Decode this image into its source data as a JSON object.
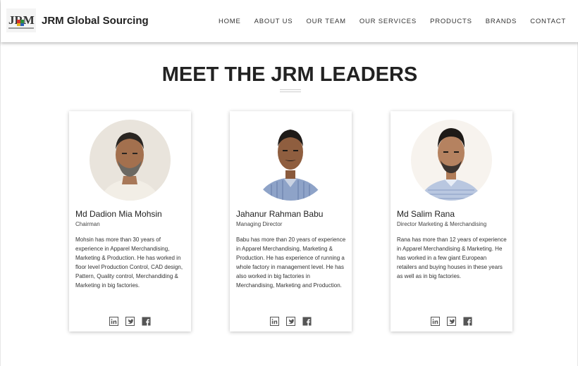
{
  "header": {
    "brand": "JRM Global Sourcing",
    "logo_icon": "jrm-logo-icon",
    "nav": [
      "HOME",
      "ABOUT US",
      "OUR TEAM",
      "OUR SERVICES",
      "PRODUCTS",
      "BRANDS",
      "CONTACT"
    ]
  },
  "section": {
    "title": "MEET THE JRM LEADERS"
  },
  "leaders": [
    {
      "name": "Md Dadion Mia Mohsin",
      "role": "Chairman",
      "bio": "Mohsin has more than 30 years of experience in Apparel Merchandising, Marketing & Production. He has worked in floor level Production Control, CAD design, Pattern, Quality control, Merchandiding & Marketing in big factories."
    },
    {
      "name": "Jahanur Rahman Babu",
      "role": "Managing Director",
      "bio": "Babu has more than 20 years of experience in Apparel Merchandising, Marketing & Production. He has experience of running a whole factory in management level. He has also worked in big factories in Merchandising, Marketing and Production."
    },
    {
      "name": "Md Salim Rana",
      "role": "Director Marketing & Merchandising",
      "bio": "Rana has more than 12 years of experience in Apparel Merchandising & Marketing. He has worked in a few giant European retailers and buying houses in these years as well as in big factories."
    }
  ],
  "social_icons": [
    "linkedin-icon",
    "twitter-icon",
    "facebook-icon"
  ],
  "colors": {
    "text": "#222222",
    "icon": "#555555",
    "photo_bg": "#e9e4dc"
  }
}
